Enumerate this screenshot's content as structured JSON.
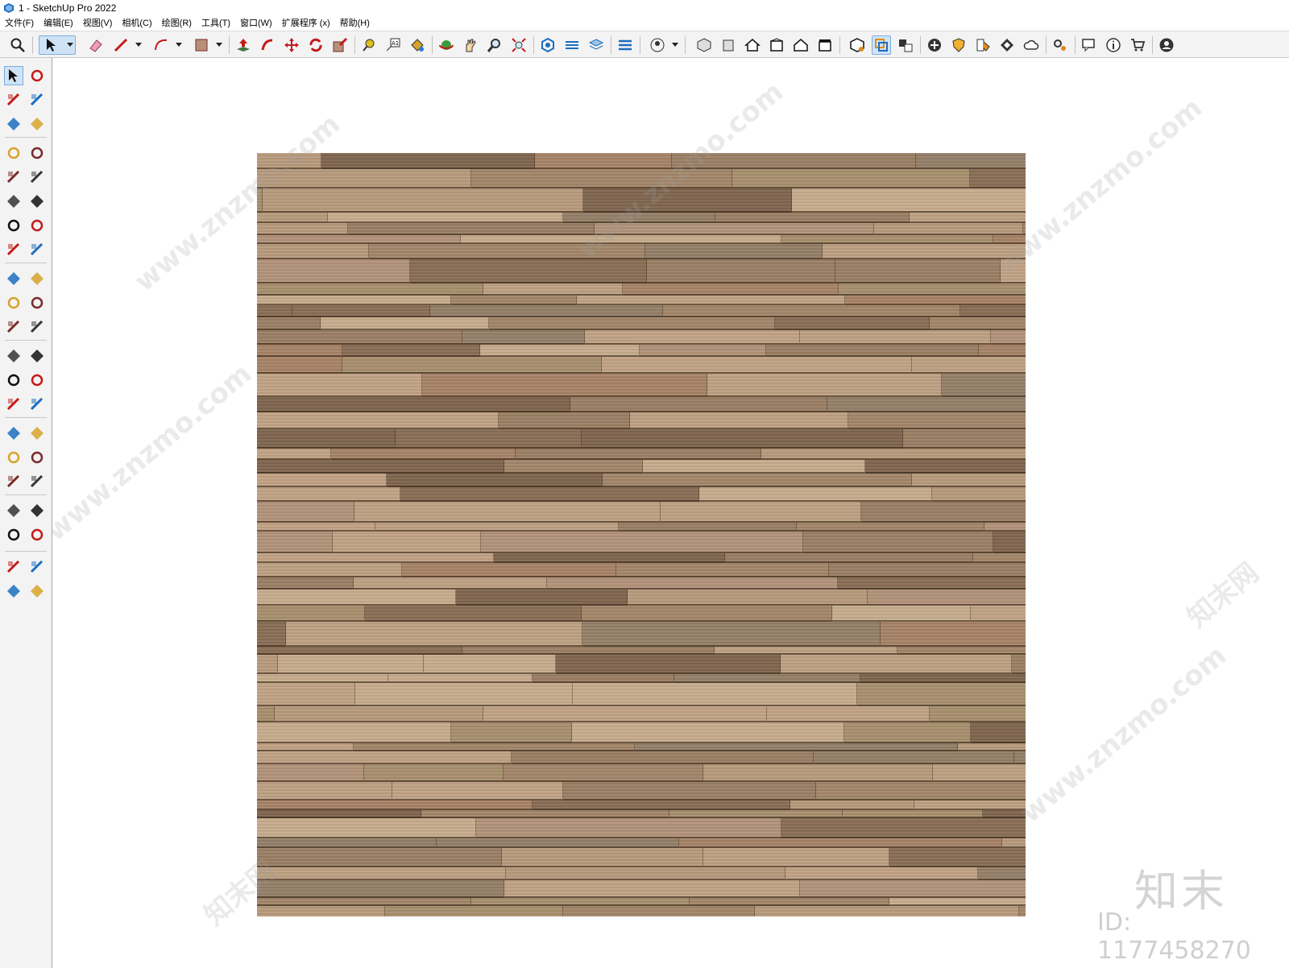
{
  "window": {
    "title": "1 - SketchUp Pro 2022"
  },
  "menu": [
    "文件(F)",
    "编辑(E)",
    "视图(V)",
    "相机(C)",
    "绘图(R)",
    "工具(T)",
    "窗口(W)",
    "扩展程序 (x)",
    "帮助(H)"
  ],
  "toolbar_icons": [
    "search-icon",
    "select-icon",
    "eraser-icon",
    "pencil-icon",
    "arc-icon",
    "rectangle-icon",
    "push-pull-icon",
    "follow-me-icon",
    "move-icon",
    "rotate-icon",
    "scale-icon",
    "tape-measure-icon",
    "text-icon",
    "paint-bucket-icon",
    "orbit-icon",
    "pan-icon",
    "zoom-icon",
    "zoom-extents-icon",
    "section-plane-icon",
    "sandbox-icon",
    "layers-icon",
    "scenes-icon",
    "user-icon",
    "iso-view-icon",
    "front-view-icon",
    "home-view-icon",
    "back-view-icon",
    "left-view-icon",
    "right-view-icon",
    "warehouse-icon",
    "extension-manager-icon",
    "send-to-layout-icon",
    "add-location-icon",
    "shield-icon",
    "style-icon",
    "texture-icon",
    "cloud-icon",
    "settings-icon",
    "chat-icon",
    "info-icon",
    "cart-icon",
    "account-icon"
  ],
  "left_tools": [
    "select-icon",
    "orbit-icon",
    "paint-bucket-icon",
    "eraser-icon",
    "component-icon",
    "tag-icon",
    "line-icon",
    "freehand-icon",
    "rectangle-icon",
    "rotated-rectangle-icon",
    "circle-icon",
    "polygon-icon",
    "arc-icon",
    "pie-icon",
    "two-point-arc-icon",
    "three-point-arc-icon",
    "move-icon",
    "push-pull-icon",
    "rotate-icon",
    "follow-me-icon",
    "scale-icon",
    "offset-icon",
    "tape-measure-icon",
    "dimension-icon",
    "protractor-icon",
    "text-icon",
    "axes-icon",
    "3d-text-icon",
    "orbit-icon",
    "pan-icon",
    "zoom-icon",
    "zoom-window-icon",
    "zoom-extents-icon",
    "previous-view-icon",
    "position-camera-icon",
    "look-around-icon",
    "walk-icon",
    "section-plane-icon",
    "sandbox-icon",
    "sandbox-from-contours-icon",
    "stamp-icon",
    "smoove-icon"
  ],
  "colors": {
    "accent": "#cfe3f7",
    "toolbar_bg": "#f3f3f3",
    "wood_dark": "#8a6f55",
    "wood_light": "#c7ad8d"
  },
  "watermarks": {
    "site": "www.znzmo.com",
    "brand": "知末网",
    "logo": "知末",
    "id": "ID: 1177458270"
  }
}
